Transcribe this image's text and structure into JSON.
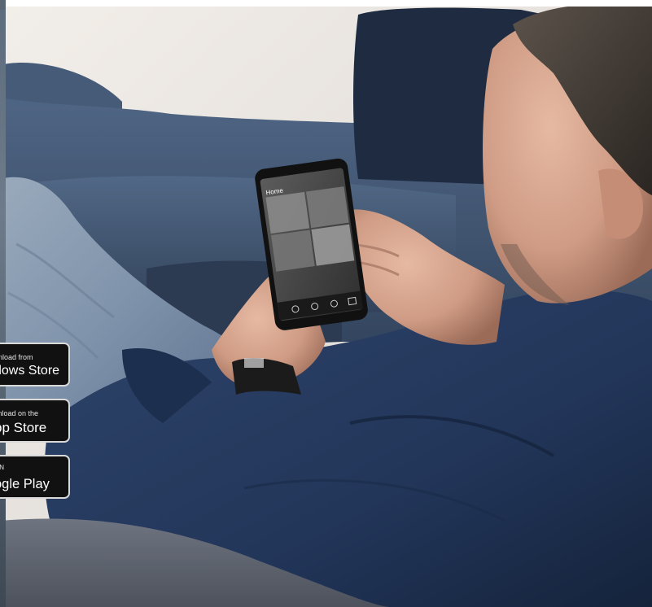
{
  "badges": {
    "windows": {
      "small": "nload from",
      "big": "dows Store"
    },
    "apple": {
      "small": "vnload on the",
      "big": "pp Store"
    },
    "google": {
      "small": "ON",
      "big": "ogle Play"
    }
  },
  "phone": {
    "title": "Home"
  },
  "colors": {
    "sofa": "#3e5372",
    "shirt": "#213556",
    "jeans": "#7f92ab",
    "wall": "#ece7e1",
    "badge_bg": "#111111"
  }
}
